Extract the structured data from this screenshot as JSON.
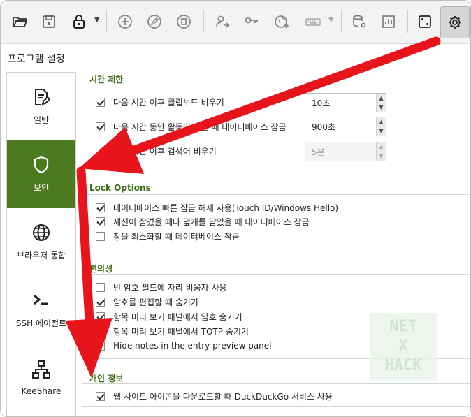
{
  "page_title": "프로그램 설정",
  "sidebar": {
    "items": [
      {
        "label": "일반"
      },
      {
        "label": "보안"
      },
      {
        "label": "브라우저 통합"
      },
      {
        "label": "SSH 에이전트"
      },
      {
        "label": "KeeShare"
      }
    ]
  },
  "sections": {
    "timeout": {
      "title": "시간 제한",
      "rows": [
        {
          "label": "다음 시간 이후 클립보드 비우기",
          "checked": true,
          "value": "10초"
        },
        {
          "label": "다음 시간 동안 활동이 없을 때 데이터베이스 잠금",
          "checked": true,
          "value": "900초"
        },
        {
          "label": "다음 시간 이후 검색어 비우기",
          "checked": false,
          "value": "5분"
        }
      ]
    },
    "lock": {
      "title": "Lock Options",
      "rows": [
        {
          "label": "데이터베이스 빠른 잠금 해제 사용(Touch ID/Windows Hello)",
          "checked": true
        },
        {
          "label": "세션이 잠겼을 때나 덮개를 닫았을 때 데이터베이스 잠금",
          "checked": true
        },
        {
          "label": "창을 최소화할 때 데이터베이스 잠금",
          "checked": false
        }
      ]
    },
    "convenience": {
      "title": "편의성",
      "rows": [
        {
          "label": "빈 암호 필드에 자리 비움자 사용",
          "checked": false
        },
        {
          "label": "암호를 편집할 때 숨기기",
          "checked": true
        },
        {
          "label": "항목 미리 보기 패널에서 암호 숨기기",
          "checked": true
        },
        {
          "label": "항목 미리 보기 패널에서 TOTP 숨기기",
          "checked": false
        },
        {
          "label": "Hide notes in the entry preview panel",
          "checked": false
        }
      ]
    },
    "privacy": {
      "title": "개인 정보",
      "rows": [
        {
          "label": "웹 사이트 아이콘을 다운로드할 때 DuckDuckGo 서비스 사용",
          "checked": true
        }
      ]
    }
  },
  "watermark": {
    "line1": "NET",
    "line2": "X",
    "line3": "HACK"
  },
  "colors": {
    "accent": "#4d7a1f",
    "section_title": "#3b6e14",
    "arrow": "#e8141c"
  }
}
